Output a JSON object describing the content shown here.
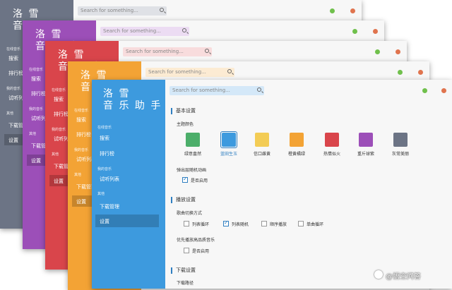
{
  "app": {
    "logo_line1": "洛 雪",
    "logo_line2": "音 乐 助 手"
  },
  "search": {
    "placeholder": "Search for something..."
  },
  "sidebar": {
    "sections": {
      "online": "在线音乐",
      "mine": "我的音乐",
      "other": "其他"
    },
    "items": {
      "search": "搜索",
      "charts": "排行榜",
      "trial_list": "试听列表",
      "downloads": "下载管理",
      "settings": "设置"
    }
  },
  "settings": {
    "basic_title": "基本设置",
    "theme_color_label": "主题颜色",
    "themes": [
      {
        "name": "绿意盎然",
        "color": "#4cae6a",
        "selected": false
      },
      {
        "name": "蓝田生玉",
        "color": "#3d9ade",
        "selected": true
      },
      {
        "name": "信口雌黄",
        "color": "#f3cc55",
        "selected": false
      },
      {
        "name": "橙黄橘绿",
        "color": "#f3a335",
        "selected": false
      },
      {
        "name": "热情似火",
        "color": "#d9454b",
        "selected": false
      },
      {
        "name": "重斤球紫",
        "color": "#9c4fb8",
        "selected": false
      },
      {
        "name": "灰常美丽",
        "color": "#6c7485",
        "selected": false
      }
    ],
    "popup_anim_label": "弹出层随机动画",
    "popup_anim_option": "是否启用",
    "popup_anim_checked": true,
    "play_title": "播放设置",
    "play_mode_label": "歌曲切换方式",
    "play_modes": [
      {
        "name": "列表循环",
        "checked": false
      },
      {
        "name": "列表随机",
        "checked": true
      },
      {
        "name": "顺序播放",
        "checked": false
      },
      {
        "name": "单曲循环",
        "checked": false
      }
    ],
    "hq_label": "优先播放高品质音乐",
    "hq_option": "是否启用",
    "hq_checked": false,
    "download_title": "下载设置",
    "download_path_label": "下载路径"
  },
  "background_windows": [
    {
      "id": "w1",
      "color": "#6c7485",
      "search_bg": "#dfe1e6"
    },
    {
      "id": "w2",
      "color": "#9c4fb8",
      "search_bg": "#ecdcf3"
    },
    {
      "id": "w3",
      "color": "#d9454b",
      "search_bg": "#f8dcdd"
    },
    {
      "id": "w4",
      "color": "#f3a335",
      "search_bg": "#fcebd3"
    }
  ],
  "watermark": "@悟空问答"
}
